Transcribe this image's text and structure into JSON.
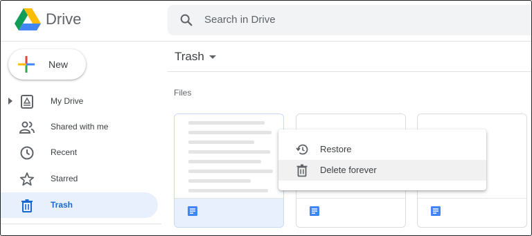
{
  "app": {
    "name": "Drive"
  },
  "search": {
    "placeholder": "Search in Drive"
  },
  "new_button": {
    "label": "New"
  },
  "sidebar": {
    "items": [
      {
        "label": "My Drive",
        "icon": "my-drive-icon"
      },
      {
        "label": "Shared with me",
        "icon": "people-icon"
      },
      {
        "label": "Recent",
        "icon": "clock-icon"
      },
      {
        "label": "Starred",
        "icon": "star-icon"
      },
      {
        "label": "Trash",
        "icon": "trash-icon",
        "active": true
      }
    ]
  },
  "main": {
    "title": "Trash",
    "section_label": "Files",
    "files": [
      {
        "type": "document",
        "selected": true
      },
      {
        "type": "document",
        "selected": false
      },
      {
        "type": "document",
        "selected": false
      }
    ]
  },
  "context_menu": {
    "items": [
      {
        "label": "Restore",
        "icon": "restore-icon"
      },
      {
        "label": "Delete forever",
        "icon": "trash-icon",
        "hovered": true
      }
    ]
  },
  "colors": {
    "accent": "#1967d2",
    "active_bg": "#e8f0fe",
    "doc_blue": "#4285f4"
  }
}
